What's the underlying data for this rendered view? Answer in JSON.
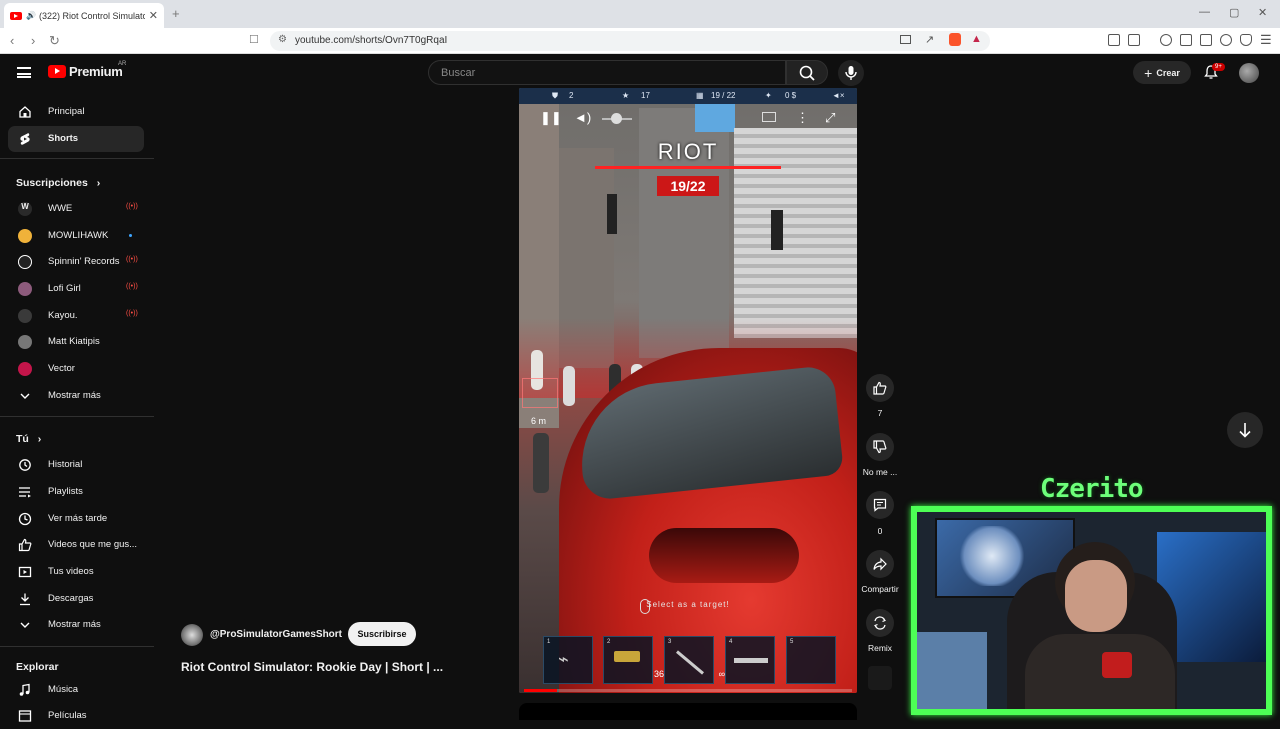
{
  "browser": {
    "tab_title": "(322) Riot Control Simulator...",
    "url": "youtube.com/shorts/Ovn7T0gRqaI"
  },
  "header": {
    "logo_text": "Premium",
    "logo_region": "AR",
    "search_placeholder": "Buscar",
    "create_label": "Crear",
    "notif_count": "9+"
  },
  "sidebar": {
    "main": [
      {
        "label": "Principal",
        "icon": "home-icon"
      },
      {
        "label": "Shorts",
        "icon": "shorts-icon",
        "active": true
      }
    ],
    "subscriptions_heading": "Suscripciones",
    "subscriptions": [
      {
        "label": "WWE",
        "status": "live",
        "avatar_color": "#2a2a2a"
      },
      {
        "label": "MOWLIHAWK",
        "status": "new",
        "avatar_color": "#f0b23a"
      },
      {
        "label": "Spinnin' Records",
        "status": "live",
        "avatar_color": "#222222"
      },
      {
        "label": "Lofi Girl",
        "status": "live",
        "avatar_color": "#8d5b7c"
      },
      {
        "label": "Kayou.",
        "status": "live",
        "avatar_color": "#3a3a3a"
      },
      {
        "label": "Matt Kiatipis",
        "status": "",
        "avatar_color": "#777777"
      },
      {
        "label": "Vector",
        "status": "",
        "avatar_color": "#c3154a"
      },
      {
        "label": "Mostrar más",
        "status": "",
        "avatar_color": ""
      }
    ],
    "you_heading": "Tú",
    "you": [
      {
        "label": "Historial",
        "icon": "history-icon"
      },
      {
        "label": "Playlists",
        "icon": "playlists-icon"
      },
      {
        "label": "Ver más tarde",
        "icon": "clock-icon"
      },
      {
        "label": "Videos que me gus...",
        "icon": "thumbs-up-icon"
      },
      {
        "label": "Tus videos",
        "icon": "your-videos-icon"
      },
      {
        "label": "Descargas",
        "icon": "download-icon"
      },
      {
        "label": "Mostrar más",
        "icon": "chevron-down-icon"
      }
    ],
    "explore_heading": "Explorar",
    "explore": [
      {
        "label": "Música",
        "icon": "music-icon"
      },
      {
        "label": "Películas",
        "icon": "movies-icon"
      }
    ]
  },
  "player": {
    "hud": {
      "shields": "2",
      "stars": "17",
      "arrests": "19 / 22",
      "money": "0 $"
    },
    "riot_title": "RIOT",
    "riot_count": "19/22",
    "distance_label": "6 m",
    "target_hint": "Select as a target!",
    "slots": [
      {
        "n": "1",
        "ammo": ""
      },
      {
        "n": "2",
        "ammo": "36"
      },
      {
        "n": "3",
        "ammo": "∞"
      },
      {
        "n": "4",
        "ammo": ""
      },
      {
        "n": "5",
        "ammo": ""
      }
    ],
    "progress": 0.1
  },
  "actions": {
    "like_count": "7",
    "dislike_label": "No me ...",
    "comments_count": "0",
    "share_label": "Compartir",
    "remix_label": "Remix"
  },
  "video": {
    "channel_handle": "@ProSimulatorGamesShort",
    "subscribe_label": "Suscribirse",
    "title": "Riot Control Simulator: Rookie Day | Short | ..."
  },
  "webcam": {
    "name": "Czerito",
    "border_color": "#4dff55"
  }
}
